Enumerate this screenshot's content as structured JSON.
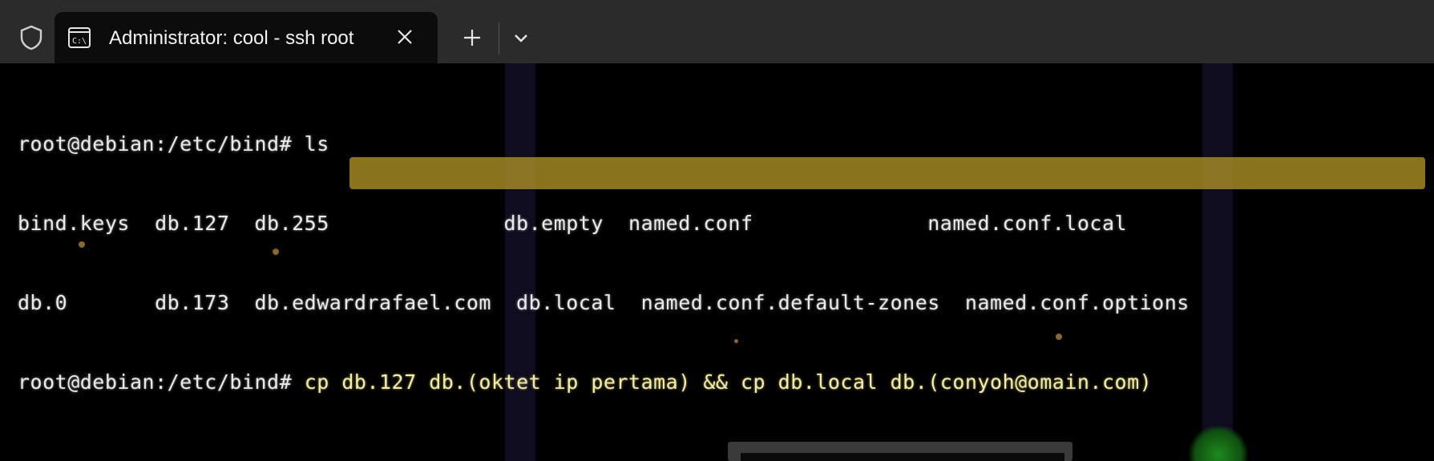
{
  "window": {
    "tab_title": "Administrator: cool - ssh  root",
    "tab_icon": "terminal-cmd-icon",
    "shield_icon": "shield-icon",
    "close_icon": "close-icon",
    "new_tab_icon": "plus-icon",
    "dropdown_icon": "chevron-down-icon"
  },
  "terminal": {
    "lines": [
      "root@debian:/etc/bind# ls",
      "bind.keys  db.127  db.255              db.empty  named.conf              named.conf.local",
      "db.0       db.173  db.edwardrafael.com  db.local  named.conf.default-zones  named.conf.options"
    ],
    "prompt": "root@debian:/etc/bind#",
    "command": " cp db.127 db.(oktet ip pertama) && cp db.local db.(conyoh@omain.com)"
  },
  "colors": {
    "titlebar": "#2b2b2b",
    "tab": "#0c0c0c",
    "terminal_bg": "#000000",
    "terminal_fg": "#eaeaea",
    "highlight": "#bea028"
  }
}
